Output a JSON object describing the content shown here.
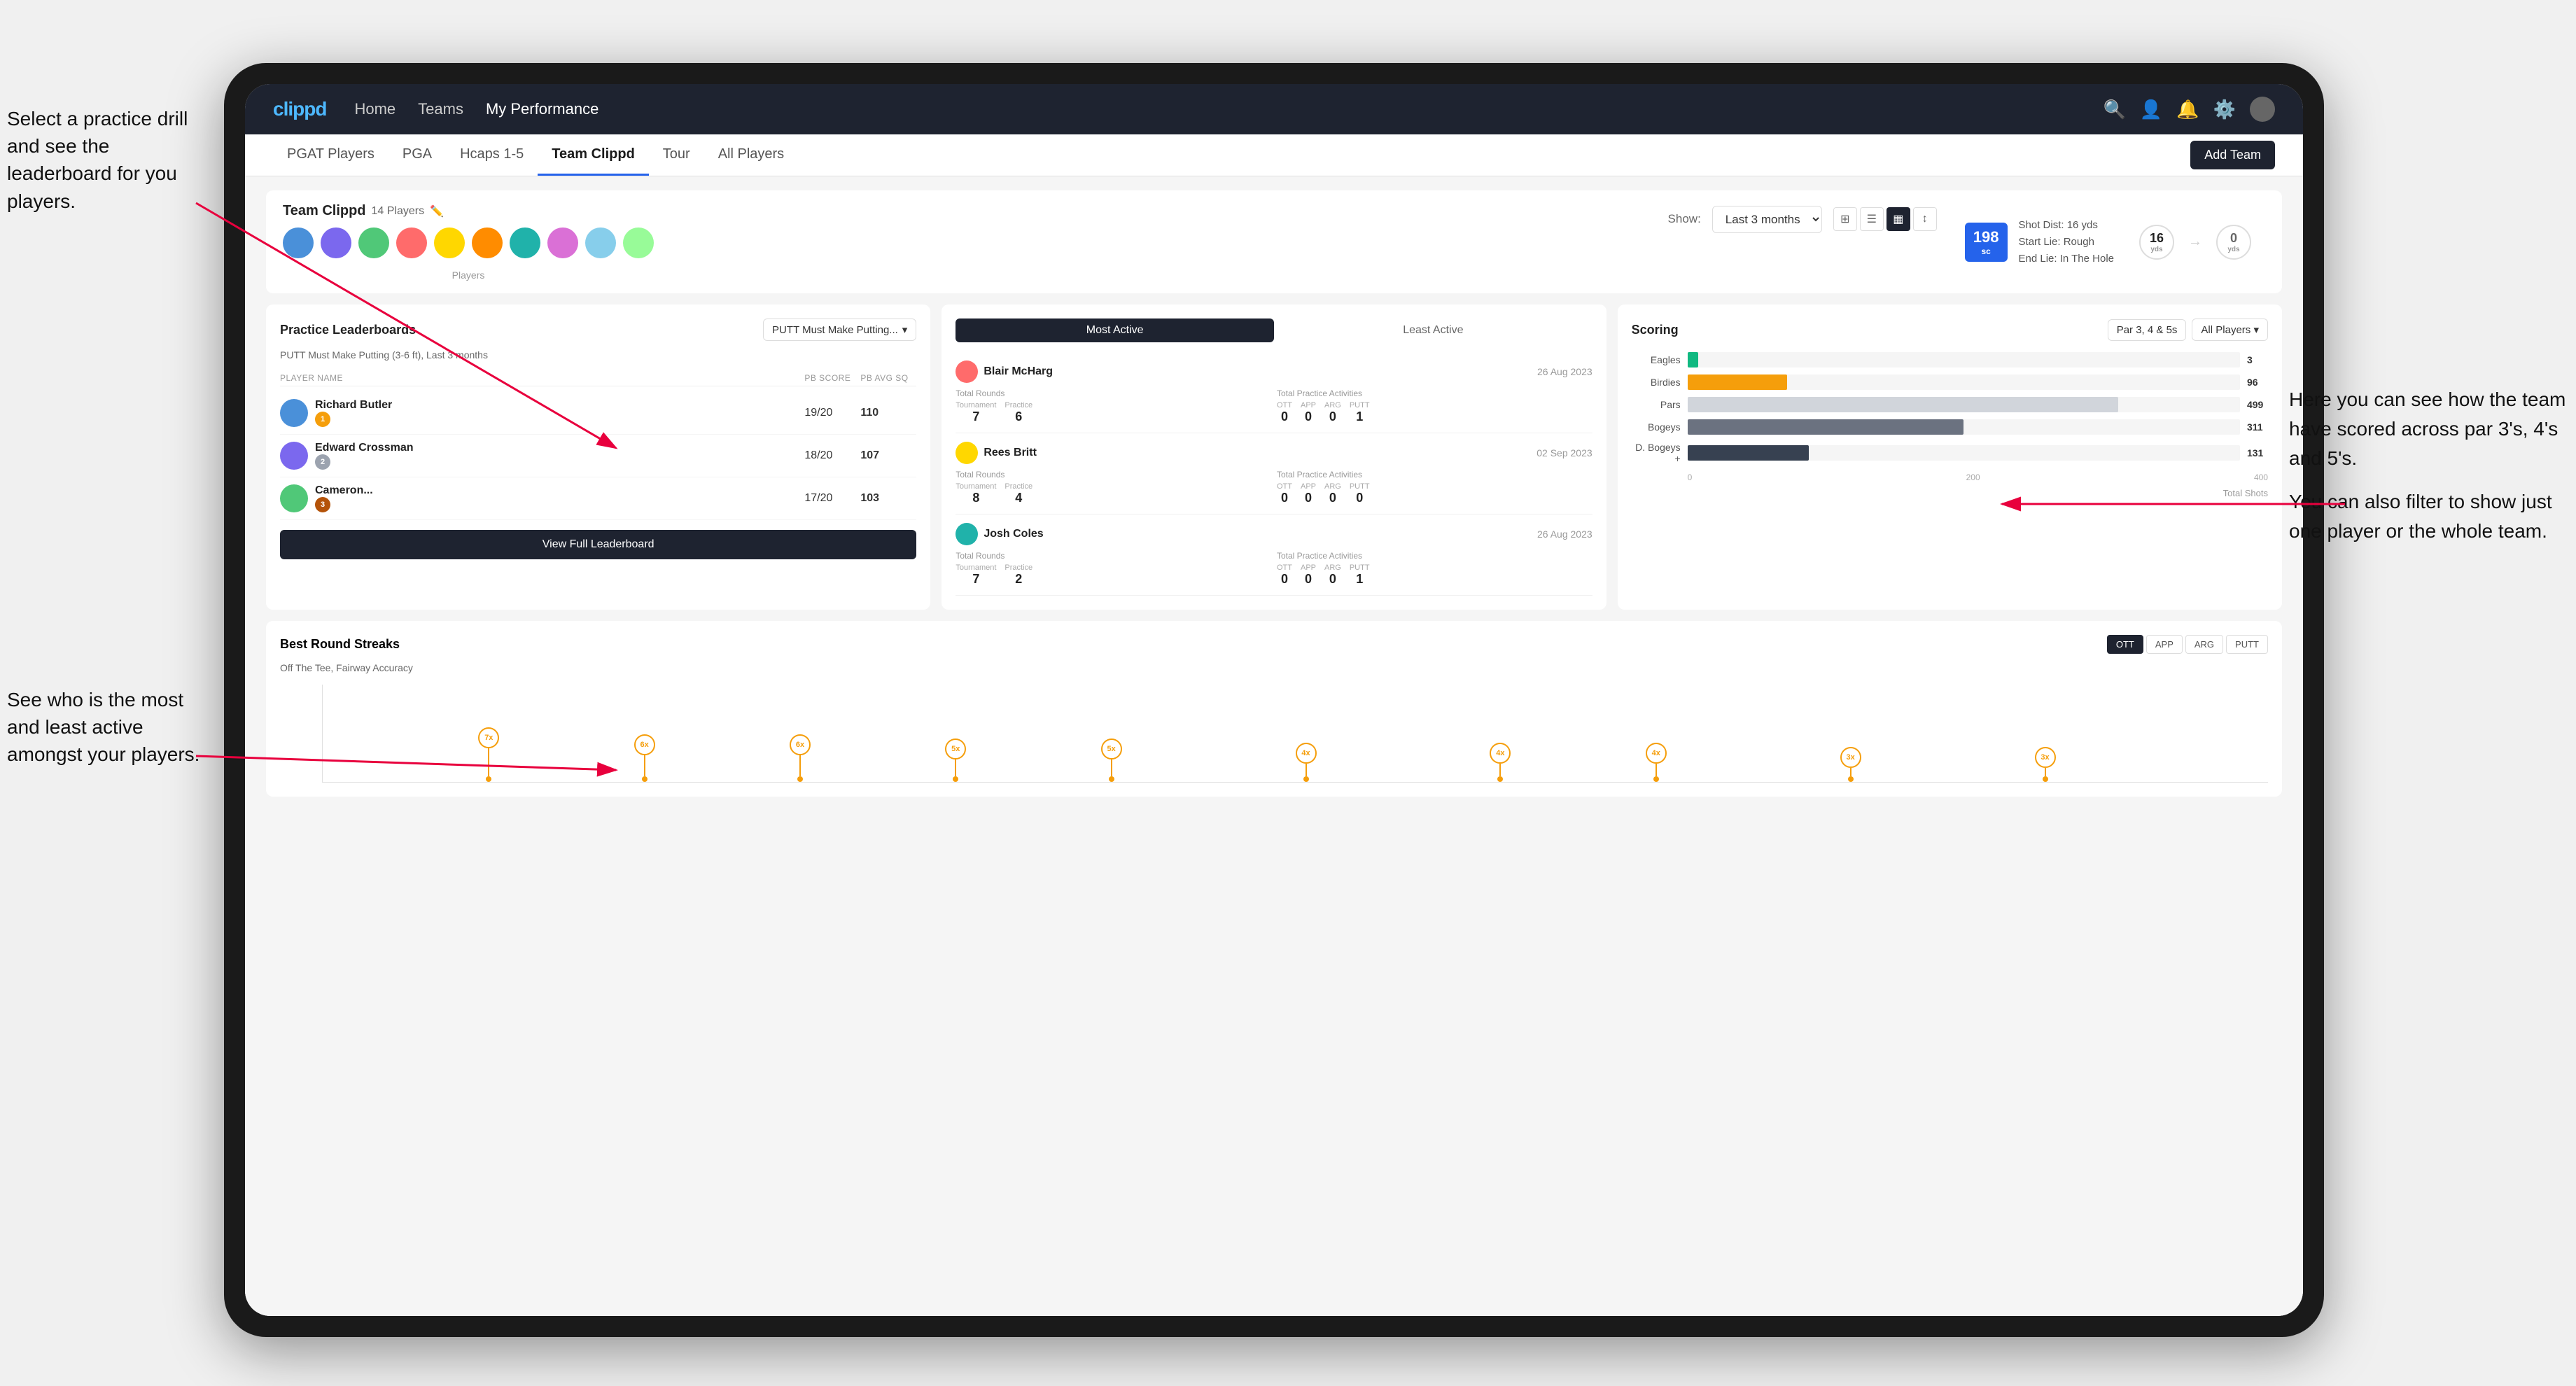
{
  "annotations": {
    "ann1": "Select a practice drill and see the leaderboard for you players.",
    "ann2": "See who is the most and least active amongst your players.",
    "ann3_line1": "Here you can see how the team have scored across par 3's, 4's and 5's.",
    "ann3_line2": "You can also filter to show just one player or the whole team."
  },
  "nav": {
    "logo": "clippd",
    "links": [
      "Home",
      "Teams",
      "My Performance"
    ],
    "active_link": "Teams"
  },
  "subnav": {
    "links": [
      "PGAT Players",
      "PGA",
      "Hcaps 1-5",
      "Team Clippd",
      "Tour",
      "All Players"
    ],
    "active": "Team Clippd",
    "add_team_label": "Add Team"
  },
  "team_header": {
    "title": "Team Clippd",
    "player_count": "14 Players",
    "show_label": "Show:",
    "show_value": "Last 3 months",
    "players_label": "Players"
  },
  "shot_detail": {
    "badge": "198",
    "badge_sub": "sc",
    "line1": "Shot Dist: 16 yds",
    "line2": "Start Lie: Rough",
    "line3": "End Lie: In The Hole",
    "circle1_val": "16",
    "circle1_label": "yds",
    "circle2_val": "0",
    "circle2_label": "yds"
  },
  "leaderboard": {
    "title": "Practice Leaderboards",
    "drill": "PUTT Must Make Putting...",
    "subtitle": "PUTT Must Make Putting (3-6 ft), Last 3 months",
    "col_player": "PLAYER NAME",
    "col_score": "PB SCORE",
    "col_avg": "PB AVG SQ",
    "players": [
      {
        "rank": 1,
        "name": "Richard Butler",
        "score": "19/20",
        "avg": "110",
        "badge": "gold"
      },
      {
        "rank": 2,
        "name": "Edward Crossman",
        "score": "18/20",
        "avg": "107",
        "badge": "silver"
      },
      {
        "rank": 3,
        "name": "Cameron...",
        "score": "17/20",
        "avg": "103",
        "badge": "bronze"
      }
    ],
    "view_full_label": "View Full Leaderboard"
  },
  "activity": {
    "tabs": [
      "Most Active",
      "Least Active"
    ],
    "active_tab": "Most Active",
    "players": [
      {
        "name": "Blair McHarg",
        "date": "26 Aug 2023",
        "total_rounds_label": "Total Rounds",
        "tournament": "7",
        "practice": "6",
        "total_practice_label": "Total Practice Activities",
        "ott": "0",
        "app": "0",
        "arg": "0",
        "putt": "1"
      },
      {
        "name": "Rees Britt",
        "date": "02 Sep 2023",
        "total_rounds_label": "Total Rounds",
        "tournament": "8",
        "practice": "4",
        "total_practice_label": "Total Practice Activities",
        "ott": "0",
        "app": "0",
        "arg": "0",
        "putt": "0"
      },
      {
        "name": "Josh Coles",
        "date": "26 Aug 2023",
        "total_rounds_label": "Total Rounds",
        "tournament": "7",
        "practice": "2",
        "total_practice_label": "Total Practice Activities",
        "ott": "0",
        "app": "0",
        "arg": "0",
        "putt": "1"
      }
    ]
  },
  "scoring": {
    "title": "Scoring",
    "filter1": "Par 3, 4 & 5s",
    "filter2": "All Players",
    "bars": [
      {
        "label": "Eagles",
        "value": 3,
        "pct": 2,
        "color": "#10b981"
      },
      {
        "label": "Birdies",
        "value": 96,
        "pct": 18,
        "color": "#f59e0b"
      },
      {
        "label": "Pars",
        "value": 499,
        "pct": 78,
        "color": "#d1d5db"
      },
      {
        "label": "Bogeys",
        "value": 311,
        "pct": 50,
        "color": "#6b7280"
      },
      {
        "label": "D. Bogeys +",
        "value": 131,
        "pct": 22,
        "color": "#374151"
      }
    ],
    "x_labels": [
      "0",
      "200",
      "400"
    ],
    "footer": "Total Shots"
  },
  "streaks": {
    "title": "Best Round Streaks",
    "subtitle": "Off The Tee, Fairway Accuracy",
    "filters": [
      "OTT",
      "APP",
      "ARG",
      "PUTT"
    ],
    "active_filter": "OTT",
    "points": [
      {
        "x": 8,
        "label": "7x"
      },
      {
        "x": 15,
        "label": "6x"
      },
      {
        "x": 21,
        "label": "6x"
      },
      {
        "x": 29,
        "label": "5x"
      },
      {
        "x": 37,
        "label": "5x"
      },
      {
        "x": 48,
        "label": "4x"
      },
      {
        "x": 56,
        "label": "4x"
      },
      {
        "x": 64,
        "label": "4x"
      },
      {
        "x": 72,
        "label": "3x"
      },
      {
        "x": 80,
        "label": "3x"
      }
    ]
  }
}
